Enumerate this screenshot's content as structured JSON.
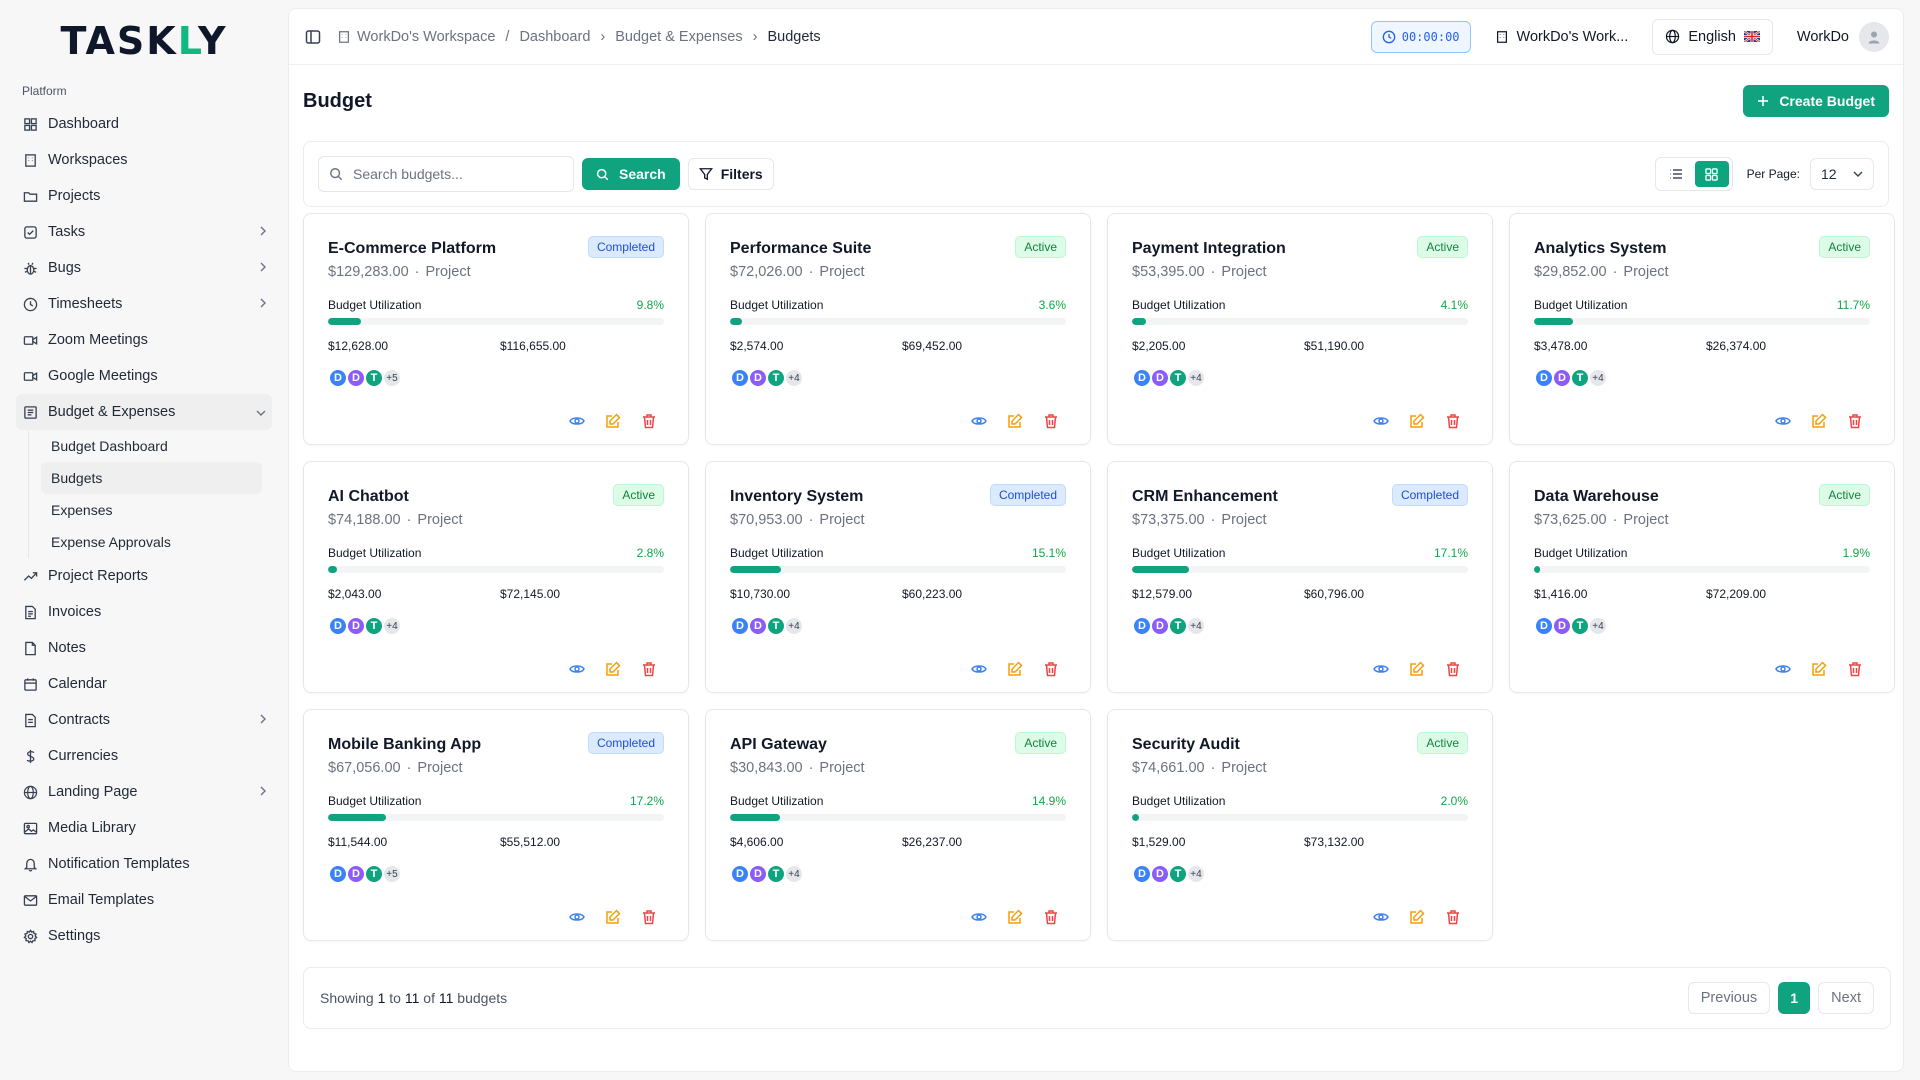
{
  "brand": {
    "logo_pre": "TASK",
    "logo_accent": "L",
    "logo_post": "Y"
  },
  "sidebar": {
    "section": "Platform",
    "items": [
      {
        "label": "Dashboard",
        "icon": "grid-icon",
        "chevron": false
      },
      {
        "label": "Workspaces",
        "icon": "building-icon",
        "chevron": false
      },
      {
        "label": "Projects",
        "icon": "folder-icon",
        "chevron": false
      },
      {
        "label": "Tasks",
        "icon": "checkbox-icon",
        "chevron": true
      },
      {
        "label": "Bugs",
        "icon": "bug-icon",
        "chevron": true
      },
      {
        "label": "Timesheets",
        "icon": "clock-icon",
        "chevron": true
      },
      {
        "label": "Zoom Meetings",
        "icon": "video-icon",
        "chevron": false
      },
      {
        "label": "Google Meetings",
        "icon": "video-icon",
        "chevron": false
      },
      {
        "label": "Budget & Expenses",
        "icon": "wallet-icon",
        "chevron": true,
        "open": true
      },
      {
        "label": "Project Reports",
        "icon": "trending-icon",
        "chevron": false
      },
      {
        "label": "Invoices",
        "icon": "file-icon",
        "chevron": false
      },
      {
        "label": "Notes",
        "icon": "note-icon",
        "chevron": false
      },
      {
        "label": "Calendar",
        "icon": "calendar-icon",
        "chevron": false
      },
      {
        "label": "Contracts",
        "icon": "contract-icon",
        "chevron": true
      },
      {
        "label": "Currencies",
        "icon": "dollar-icon",
        "chevron": false
      },
      {
        "label": "Landing Page",
        "icon": "globe-icon",
        "chevron": true
      },
      {
        "label": "Media Library",
        "icon": "image-icon",
        "chevron": false
      },
      {
        "label": "Notification Templates",
        "icon": "bell-icon",
        "chevron": false
      },
      {
        "label": "Email Templates",
        "icon": "mail-icon",
        "chevron": false
      },
      {
        "label": "Settings",
        "icon": "gear-icon",
        "chevron": false
      }
    ],
    "subitems": [
      {
        "label": "Budget Dashboard",
        "active": false
      },
      {
        "label": "Budgets",
        "active": true
      },
      {
        "label": "Expenses",
        "active": false
      },
      {
        "label": "Expense Approvals",
        "active": false
      }
    ]
  },
  "topbar": {
    "breadcrumb": [
      "WorkDo's Workspace",
      "Dashboard",
      "Budget & Expenses",
      "Budgets"
    ],
    "timer": "00:00:00",
    "workspace": "WorkDo's Work...",
    "language": "English",
    "user": "WorkDo"
  },
  "page": {
    "title": "Budget",
    "create_label": "Create Budget",
    "search_placeholder": "Search budgets...",
    "search_label": "Search",
    "filters_label": "Filters",
    "per_page_label": "Per Page:",
    "per_page_value": "12"
  },
  "labels": {
    "type": "Project",
    "utilization": "Budget Utilization"
  },
  "budgets": [
    {
      "title": "E-Commerce Platform",
      "status": "Completed",
      "total": "$129,283.00",
      "pct": "9.8%",
      "pct_value": 9.8,
      "spent": "$12,628.00",
      "remaining": "$116,655.00",
      "more": "+5"
    },
    {
      "title": "Performance Suite",
      "status": "Active",
      "total": "$72,026.00",
      "pct": "3.6%",
      "pct_value": 3.6,
      "spent": "$2,574.00",
      "remaining": "$69,452.00",
      "more": "+4"
    },
    {
      "title": "Payment Integration",
      "status": "Active",
      "total": "$53,395.00",
      "pct": "4.1%",
      "pct_value": 4.1,
      "spent": "$2,205.00",
      "remaining": "$51,190.00",
      "more": "+4"
    },
    {
      "title": "Analytics System",
      "status": "Active",
      "total": "$29,852.00",
      "pct": "11.7%",
      "pct_value": 11.7,
      "spent": "$3,478.00",
      "remaining": "$26,374.00",
      "more": "+4"
    },
    {
      "title": "AI Chatbot",
      "status": "Active",
      "total": "$74,188.00",
      "pct": "2.8%",
      "pct_value": 2.8,
      "spent": "$2,043.00",
      "remaining": "$72,145.00",
      "more": "+4"
    },
    {
      "title": "Inventory System",
      "status": "Completed",
      "total": "$70,953.00",
      "pct": "15.1%",
      "pct_value": 15.1,
      "spent": "$10,730.00",
      "remaining": "$60,223.00",
      "more": "+4"
    },
    {
      "title": "CRM Enhancement",
      "status": "Completed",
      "total": "$73,375.00",
      "pct": "17.1%",
      "pct_value": 17.1,
      "spent": "$12,579.00",
      "remaining": "$60,796.00",
      "more": "+4"
    },
    {
      "title": "Data Warehouse",
      "status": "Active",
      "total": "$73,625.00",
      "pct": "1.9%",
      "pct_value": 1.9,
      "spent": "$1,416.00",
      "remaining": "$72,209.00",
      "more": "+4"
    },
    {
      "title": "Mobile Banking App",
      "status": "Completed",
      "total": "$67,056.00",
      "pct": "17.2%",
      "pct_value": 17.2,
      "spent": "$11,544.00",
      "remaining": "$55,512.00",
      "more": "+5"
    },
    {
      "title": "API Gateway",
      "status": "Active",
      "total": "$30,843.00",
      "pct": "14.9%",
      "pct_value": 14.9,
      "spent": "$4,606.00",
      "remaining": "$26,237.00",
      "more": "+4"
    },
    {
      "title": "Security Audit",
      "status": "Active",
      "total": "$74,661.00",
      "pct": "2.0%",
      "pct_value": 2.0,
      "spent": "$1,529.00",
      "remaining": "$73,132.00",
      "more": "+4"
    }
  ],
  "members": [
    "D",
    "D",
    "T"
  ],
  "footer": {
    "showing_pre": "Showing ",
    "from": "1",
    "to_word": " to ",
    "to": "11",
    "of_word": " of ",
    "total": "11",
    "suffix": " budgets",
    "previous": "Previous",
    "page": "1",
    "next": "Next"
  },
  "colors": {
    "accent": "#10a37f",
    "completed": "#1d4ed8",
    "active": "#15803d"
  }
}
